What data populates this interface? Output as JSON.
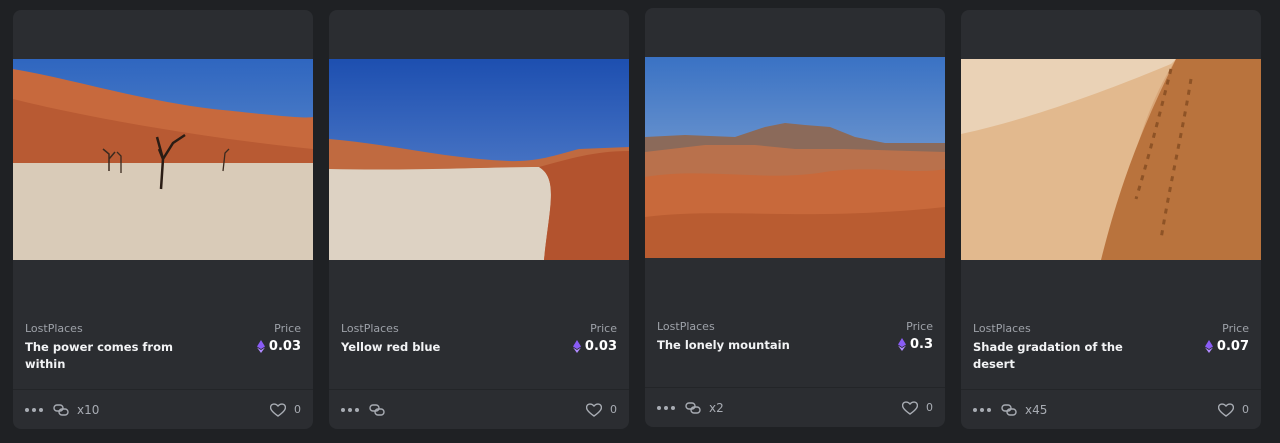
{
  "labels": {
    "price": "Price"
  },
  "colors": {
    "background": "#1f2124",
    "card": "#2b2d31",
    "eth_accent": "#8a5cf6"
  },
  "icons": {
    "more": "more-dots-icon",
    "link": "link-chain-icon",
    "like": "heart-icon",
    "currency": "ethereum-icon"
  },
  "cards": [
    {
      "collection": "LostPlaces",
      "title": "The power comes from within",
      "price": "0.03",
      "editions": "x10",
      "likes": "0",
      "image": "desert salt pan with dead trees"
    },
    {
      "collection": "LostPlaces",
      "title": "Yellow red blue",
      "price": "0.03",
      "editions": "",
      "likes": "0",
      "image": "pale clay pan beside red dune"
    },
    {
      "collection": "LostPlaces",
      "title": "The lonely mountain",
      "price": "0.3",
      "editions": "x2",
      "likes": "0",
      "image": "rocky mountain above red dunes"
    },
    {
      "collection": "LostPlaces",
      "title": "Shade gradation of the desert",
      "price": "0.07",
      "editions": "x45",
      "likes": "0",
      "image": "footsteps on a sand dune ridge"
    }
  ]
}
